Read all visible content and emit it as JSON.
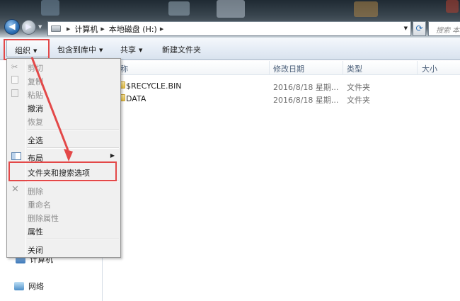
{
  "address": {
    "crumbs": [
      "计算机",
      "本地磁盘 (H:)"
    ],
    "search_placeholder": "搜索 本地"
  },
  "toolbar": {
    "organize": "组织",
    "include_library": "包含到库中",
    "share": "共享",
    "new_folder": "新建文件夹"
  },
  "organize_menu": {
    "items": [
      {
        "label": "剪切",
        "disabled": true
      },
      {
        "label": "复制",
        "disabled": true
      },
      {
        "label": "粘贴",
        "disabled": true
      },
      {
        "label": "撤消",
        "disabled": false
      },
      {
        "label": "恢复",
        "disabled": true
      },
      {
        "label": "全选",
        "disabled": false
      },
      {
        "label": "布局",
        "disabled": false,
        "submenu": true
      },
      {
        "label": "文件夹和搜索选项",
        "disabled": false
      },
      {
        "label": "删除",
        "disabled": true
      },
      {
        "label": "重命名",
        "disabled": true
      },
      {
        "label": "删除属性",
        "disabled": true
      },
      {
        "label": "属性",
        "disabled": false
      },
      {
        "label": "关闭",
        "disabled": false
      }
    ]
  },
  "columns": {
    "name": "称",
    "modified": "修改日期",
    "type": "类型",
    "size": "大小"
  },
  "files": [
    {
      "name": "$RECYCLE.BIN",
      "modified": "2016/8/18 星期...",
      "type": "文件夹"
    },
    {
      "name": "DATA",
      "modified": "2016/8/18 星期...",
      "type": "文件夹"
    }
  ],
  "nav": {
    "computer": "计算机",
    "network": "网络"
  },
  "colors": {
    "highlight": "#e34848",
    "menu_bg": "#f0f0f0"
  }
}
